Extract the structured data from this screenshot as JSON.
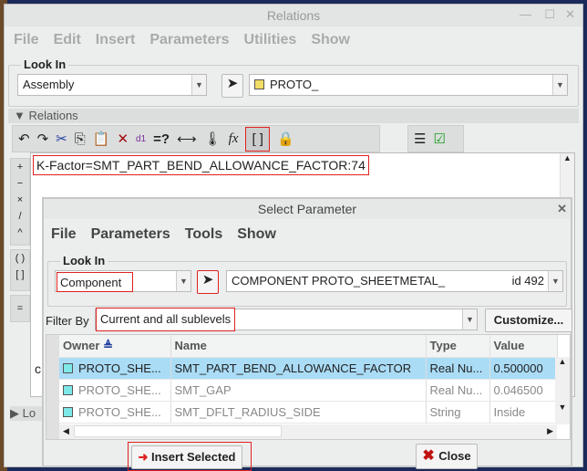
{
  "relations_window": {
    "title": "Relations",
    "menu": [
      "File",
      "Edit",
      "Insert",
      "Parameters",
      "Utilities",
      "Show"
    ],
    "look_in": {
      "label": "Look In",
      "type_value": "Assembly",
      "model_value": "PROTO_"
    },
    "relations_section": "Relations",
    "toolbar": [
      "undo-icon",
      "redo-icon",
      "cut-icon",
      "copy-icon",
      "paste-icon",
      "delete-icon",
      "switch-dimensions-icon",
      "evaluate-icon",
      "show-dimension-icon",
      "sort-relations-icon",
      "insert-function-icon",
      "insert-parameter-icon",
      "verify-icon",
      "local-parameters-icon",
      "sort-icon"
    ],
    "toolbar_text": {
      "eval": "=?",
      "fx": "fx",
      "param": "[ ]"
    },
    "operators": [
      "+",
      "−",
      "×",
      "/",
      "^",
      "( )",
      "[ ]",
      "="
    ],
    "editor_text": "K-Factor=SMT_PART_BEND_ALLOWANCE_FACTOR:74",
    "editor_partial": "c",
    "local_section": "Lo"
  },
  "select_parameter": {
    "title": "Select Parameter",
    "menu": [
      "File",
      "Parameters",
      "Tools",
      "Show"
    ],
    "look_in": {
      "label": "Look In",
      "type_value": "Component",
      "model_value": "COMPONENT PROTO_SHEETMETAL_",
      "model_id": "id 492"
    },
    "filter": {
      "label": "Filter By",
      "value": "Current and all sublevels",
      "customize": "Customize..."
    },
    "columns": [
      "Owner",
      "Name",
      "Type",
      "Value"
    ],
    "rows": [
      {
        "owner": "PROTO_SHE...",
        "name": "SMT_PART_BEND_ALLOWANCE_FACTOR",
        "type": "Real Nu...",
        "value": "0.500000"
      },
      {
        "owner": "PROTO_SHE...",
        "name": "SMT_GAP",
        "type": "Real Nu...",
        "value": "0.046500"
      },
      {
        "owner": "PROTO_SHE...",
        "name": "SMT_DFLT_RADIUS_SIDE",
        "type": "String",
        "value": "Inside"
      }
    ],
    "insert_button": "Insert Selected",
    "close_button": "Close"
  },
  "colors": {
    "highlight": "#e02020",
    "selected_row": "#aadcf6"
  }
}
